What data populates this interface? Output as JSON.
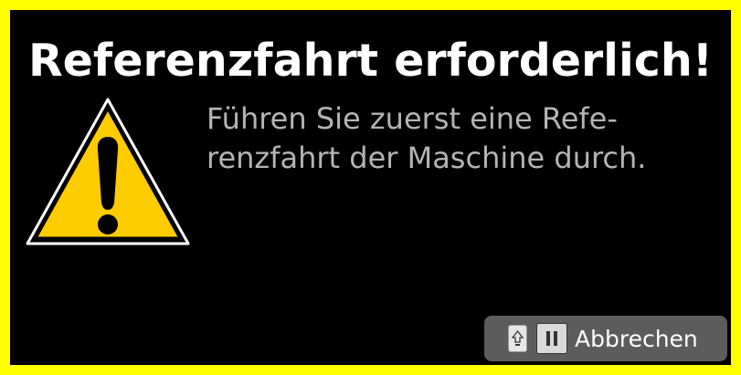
{
  "dialog": {
    "title": "Referenzfahrt erforderlich!",
    "message_line1": "Führen Sie zuerst eine Refe-",
    "message_line2": "renzfahrt der Maschine durch.",
    "icon": "warning-triangle-icon",
    "border_color": "#ffff00",
    "background_color": "#000000",
    "warning_color": "#ffcc00"
  },
  "cancel_button": {
    "label": "Abbrechen",
    "shortcut_icons": [
      "shift-key-icon",
      "pause-key-icon"
    ]
  }
}
